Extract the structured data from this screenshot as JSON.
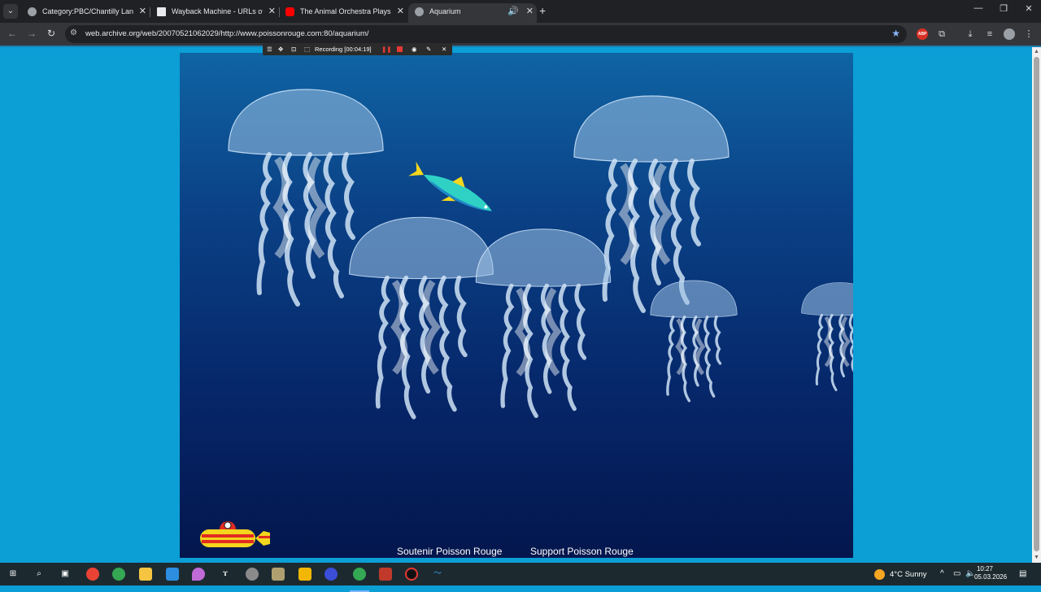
{
  "browser": {
    "tabs": [
      {
        "title": "Category:PBC/Chantilly Lane | A",
        "favicon_color": "#9aa0a6",
        "active": false
      },
      {
        "title": "Wayback Machine - URLs of htt",
        "favicon_color": "#e8eaed",
        "active": false
      },
      {
        "title": "The Animal Orchestra Plays Bac",
        "favicon_color": "#ff0000",
        "active": false
      },
      {
        "title": "Aquarium",
        "favicon_color": "#9aa0a6",
        "active": true
      }
    ],
    "url": "web.archive.org/web/20070521062029/http://www.poissonrouge.com:80/aquarium/"
  },
  "recorder": {
    "status": "Recording [00:04:19]"
  },
  "page": {
    "links": [
      "Soutenir Poisson Rouge",
      "Support Poisson Rouge"
    ],
    "colors": {
      "background": "#0b9fd6",
      "water_top": "#0f64a3",
      "water_bottom": "#04164d"
    }
  },
  "taskbar": {
    "weather": "4°C  Sunny",
    "time": "10:27",
    "date": "05.03.2026"
  }
}
